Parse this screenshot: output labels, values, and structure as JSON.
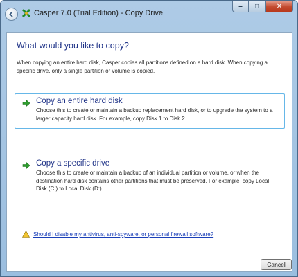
{
  "window": {
    "title": "Casper 7.0 (Trial Edition) - Copy Drive",
    "buttons": {
      "minimize": "–",
      "maximize": "□",
      "close": "✕"
    }
  },
  "page": {
    "heading": "What would you like to copy?",
    "intro": "When copying an entire hard disk, Casper copies all partitions defined on a hard disk. When copying a specific drive, only a single partition or volume is copied."
  },
  "options": [
    {
      "title": "Copy an entire hard disk",
      "description": "Choose this to create or maintain a backup replacement hard disk, or to upgrade the system to a larger capacity hard disk. For example, copy Disk 1 to Disk 2."
    },
    {
      "title": "Copy a specific drive",
      "description": "Choose this to create or maintain a backup of an individual partition or volume, or when the destination hard disk contains other partitions that must be preserved. For example, copy Local Disk (C:) to Local Disk (D:)."
    }
  ],
  "footer": {
    "help_link": "Should I disable my antivirus, anti-spyware, or personal firewall software?",
    "cancel_label": "Cancel"
  },
  "colors": {
    "heading": "#1e3287",
    "accent_arrow": "#2f9e2f",
    "selected_border": "#66b7e8",
    "close_button": "#c34b2f"
  },
  "icons": [
    "back-arrow-icon",
    "casper-app-icon",
    "green-arrow-icon",
    "warning-icon"
  ]
}
